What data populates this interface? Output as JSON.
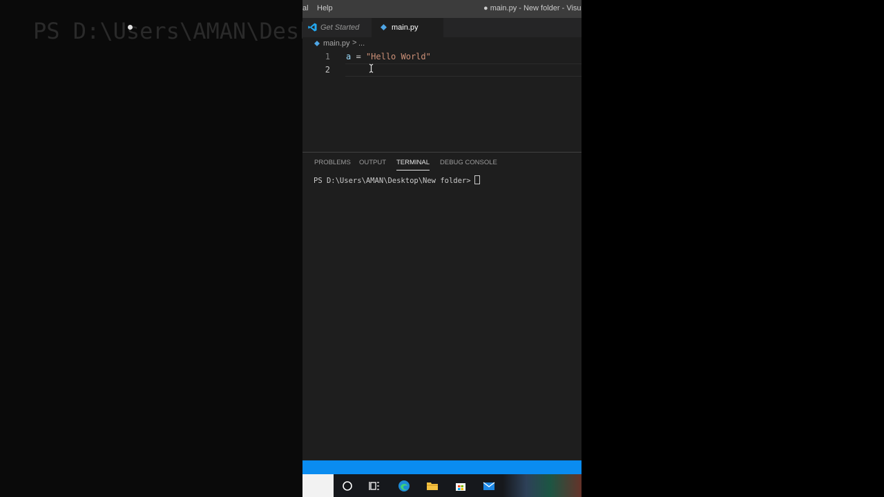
{
  "background_ghost_text": "PS D:\\Users\\AMAN\\Desk",
  "menubar": {
    "items": [
      "al",
      "Help"
    ],
    "window_title": "● main.py - New folder - Visual S"
  },
  "tabs": [
    {
      "label": "Get Started",
      "icon": "vscode-logo-icon",
      "active": false
    },
    {
      "label": "main.py",
      "icon": "python-file-icon",
      "active": true,
      "modified": true
    }
  ],
  "breadcrumb": {
    "file": "main.py",
    "separator": ">",
    "rest": "..."
  },
  "editor": {
    "line_numbers": [
      "1",
      "2"
    ],
    "code": {
      "var": "a",
      "op": " = ",
      "str": "\"Hello World\""
    }
  },
  "panel": {
    "tabs": [
      "PROBLEMS",
      "OUTPUT",
      "TERMINAL",
      "DEBUG CONSOLE"
    ],
    "active_tab": "TERMINAL",
    "terminal_prompt": "PS D:\\Users\\AMAN\\Desktop\\New folder>"
  },
  "colors": {
    "statusbar": "#0a8cf0",
    "string": "#ce9178",
    "variable": "#9cdcfe"
  },
  "taskbar_icons": [
    "search-circle-icon",
    "task-view-icon",
    "edge-icon",
    "file-explorer-icon",
    "store-icon",
    "mail-icon"
  ]
}
